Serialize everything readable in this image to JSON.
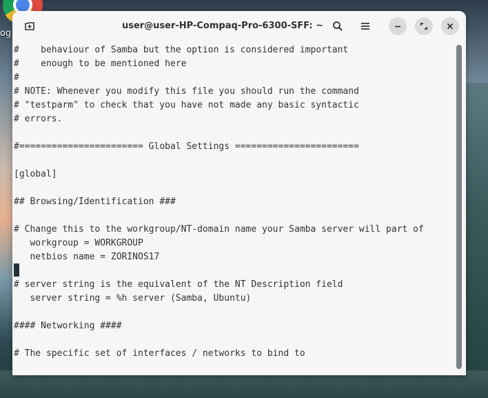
{
  "desktop": {
    "icon_label": "og"
  },
  "window": {
    "title": "user@user-HP-Compaq-Pro-6300-SFF: ~",
    "buttons": {
      "new_tab": "new-tab-icon",
      "search": "search-icon",
      "menu": "hamburger-menu-icon",
      "minimize": "minimize-icon",
      "maximize": "maximize-icon",
      "close": "close-icon"
    }
  },
  "terminal": {
    "lines": [
      "#    behaviour of Samba but the option is considered important",
      "#    enough to be mentioned here",
      "#",
      "# NOTE: Whenever you modify this file you should run the command",
      "# \"testparm\" to check that you have not made any basic syntactic",
      "# errors.",
      "",
      "#======================= Global Settings =======================",
      "",
      "[global]",
      "",
      "## Browsing/Identification ###",
      "",
      "# Change this to the workgroup/NT-domain name your Samba server will part of",
      "   workgroup = WORKGROUP",
      "   netbios name = ZORINOS17",
      "",
      "# server string is the equivalent of the NT Description field",
      "   server string = %h server (Samba, Ubuntu)",
      "",
      "#### Networking ####",
      "",
      "# The specific set of interfaces / networks to bind to"
    ]
  }
}
